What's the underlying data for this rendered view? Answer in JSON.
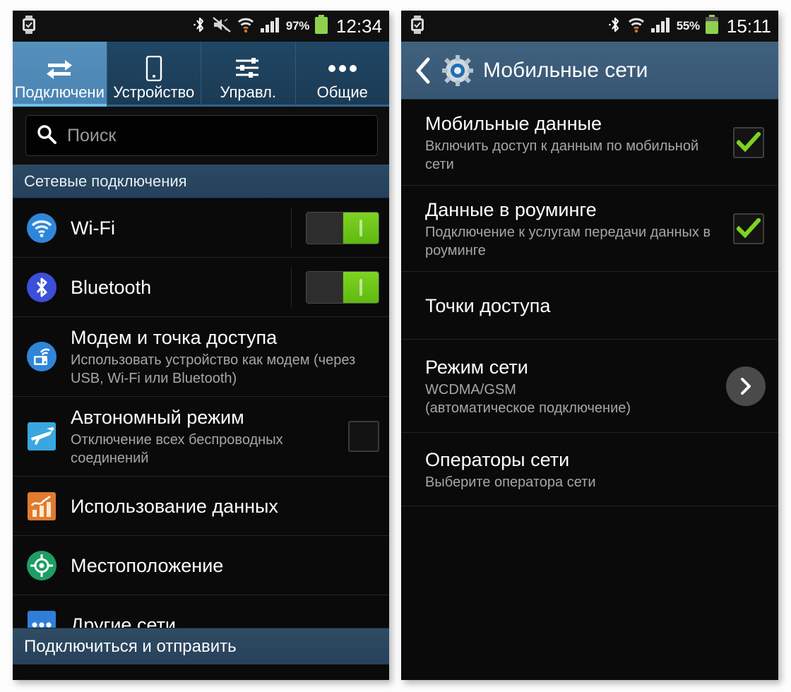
{
  "left_phone": {
    "status_bar": {
      "icons": [
        "smartwatch-icon",
        "bluetooth-icon",
        "mute-vibrate-off-icon",
        "wifi-icon",
        "signal-bars-icon"
      ],
      "battery_percent": "97%",
      "clock": "12:34"
    },
    "tabs": [
      {
        "label": "Подключени",
        "icon": "connections-arrows-icon",
        "active": true
      },
      {
        "label": "Устройство",
        "icon": "device-phone-icon",
        "active": false
      },
      {
        "label": "Управл.",
        "icon": "sliders-icon",
        "active": false
      },
      {
        "label": "Общие",
        "icon": "more-dots-icon",
        "active": false
      }
    ],
    "search": {
      "placeholder": "Поиск",
      "value": "",
      "icon": "search-icon"
    },
    "section_header": "Сетевые подключения",
    "rows": [
      {
        "title": "Wi-Fi",
        "subtitle": "",
        "icon": "wifi-round-icon",
        "control": "toggle",
        "state": "on"
      },
      {
        "title": "Bluetooth",
        "subtitle": "",
        "icon": "bluetooth-round-icon",
        "control": "toggle",
        "state": "on"
      },
      {
        "title": "Модем и точка доступа",
        "subtitle": "Использовать устройство как модем (через USB, Wi-Fi или Bluetooth)",
        "icon": "tethering-hotspot-icon",
        "control": "none",
        "state": ""
      },
      {
        "title": "Автономный режим",
        "subtitle": "Отключение всех беспроводных соединений",
        "icon": "airplane-icon",
        "control": "checkbox",
        "state": "off"
      },
      {
        "title": "Использование данных",
        "subtitle": "",
        "icon": "data-usage-chart-icon",
        "control": "none",
        "state": ""
      },
      {
        "title": "Местоположение",
        "subtitle": "",
        "icon": "location-target-icon",
        "control": "none",
        "state": ""
      },
      {
        "title": "Другие сети",
        "subtitle": "",
        "icon": "more-networks-dots-icon",
        "control": "none",
        "state": ""
      }
    ],
    "bottom_bar": "Подключиться и отправить"
  },
  "right_phone": {
    "status_bar": {
      "icons": [
        "smartwatch-icon",
        "bluetooth-icon",
        "wifi-icon",
        "signal-bars-icon"
      ],
      "battery_percent": "55%",
      "clock": "15:11"
    },
    "action_bar": {
      "back_icon": "back-chevron-icon",
      "app_icon": "gear-icon",
      "title": "Мобильные сети"
    },
    "rows": [
      {
        "title": "Мобильные данные",
        "subtitle": "Включить доступ к данным по мобильной сети",
        "control": "checkbox",
        "state": "on"
      },
      {
        "title": "Данные в роуминге",
        "subtitle": "Подключение к услугам передачи данных в роуминге",
        "control": "checkbox",
        "state": "on"
      },
      {
        "title": "Точки доступа",
        "subtitle": "",
        "control": "none",
        "state": ""
      },
      {
        "title": "Режим сети",
        "subtitle": "WCDMA/GSM\n(автоматическое подключение)",
        "subtitle_line1": "WCDMA/GSM",
        "subtitle_line2": "(автоматическое подключение)",
        "control": "chevron",
        "state": ""
      },
      {
        "title": "Операторы сети",
        "subtitle": "Выберите оператора сети",
        "control": "none",
        "state": ""
      }
    ]
  },
  "colors": {
    "accent_blue": "#4a84b2",
    "tab_bar_dark": "#1e415e",
    "toggle_green": "#7ed321",
    "check_green": "#7ed321",
    "list_bg": "#0a0a0a",
    "status_bar_bg": "#101010",
    "action_bar_blue": "#40627f",
    "section_header_blue": "#2b4a63"
  }
}
